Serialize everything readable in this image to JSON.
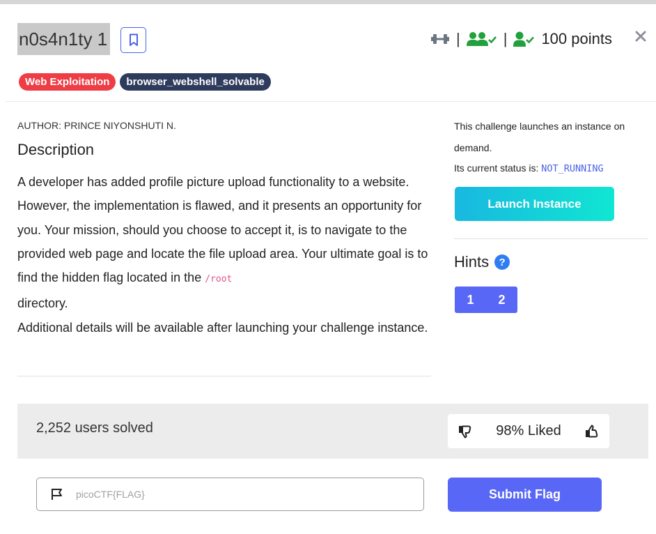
{
  "header": {
    "title": "n0s4n1ty 1",
    "separator": "|",
    "points": "100 points"
  },
  "tags": [
    "Web Exploitation",
    "browser_webshell_solvable"
  ],
  "colors": {
    "tag_category": "#ee3d45",
    "tag_dark": "#2e3b5c",
    "accent": "#5867f5",
    "stat_icons": "#22a03c"
  },
  "challenge": {
    "author": "AUTHOR: PRINCE NIYONSHUTI N.",
    "description_heading": "Description",
    "desc_part1": "A developer has added profile picture upload functionality to a website. However, the implementation is flawed, and it presents an opportunity for you. Your mission, should you choose to accept it, is to navigate to the provided web page and locate the file upload area. Your ultimate goal is to find the hidden flag located in the",
    "desc_code": "/root",
    "desc_part2": "directory.",
    "desc_part3": "Additional details will be available after launching your challenge instance."
  },
  "instance": {
    "info": "This challenge launches an instance on demand.",
    "status_label": "Its current status is:",
    "status_value": "NOT_RUNNING",
    "launch_label": "Launch Instance"
  },
  "hints": {
    "title": "Hints",
    "help_icon_text": "?",
    "items": [
      "1",
      "2"
    ]
  },
  "stats": {
    "solved": "2,252 users solved",
    "liked": "98% Liked"
  },
  "flag_form": {
    "placeholder": "picoCTF{FLAG}",
    "submit_label": "Submit Flag"
  },
  "icons": {
    "bookmark": "bookmark-icon",
    "difficulty": "dumbbell-icon",
    "users_solved": "users-check-icon",
    "user_solved": "user-check-icon",
    "close": "close-icon",
    "dislike": "thumbs-down-icon",
    "like": "thumbs-up-icon",
    "flag": "flag-icon"
  }
}
